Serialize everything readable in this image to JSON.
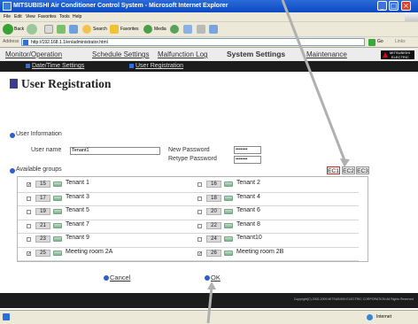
{
  "window": {
    "title": "MITSUBISHI Air Conditioner Control System - Microsoft Internet Explorer"
  },
  "menu_items": [
    "File",
    "Edit",
    "View",
    "Favorites",
    "Tools",
    "Help"
  ],
  "toolbar": {
    "back_label": "Back",
    "search_label": "Search",
    "favorites_label": "Favorites",
    "media_label": "Media"
  },
  "address_bar": {
    "label": "Address",
    "url": "http://192.168.1.1/en/administrator.html",
    "go_label": "Go",
    "links_label": "Links"
  },
  "nav": {
    "monitor": "Monitor/Operation",
    "schedule": "Schedule Settings",
    "malfunction": "Malfunction Log",
    "system": "System Settings",
    "maintenance": "Maintenance",
    "brand_line1": "MITSUBISHI",
    "brand_line2": "ELECTRIC"
  },
  "subnav": {
    "datetime": "Date/Time Settings",
    "user_reg": "User Registration"
  },
  "page": {
    "title": "User Registration"
  },
  "user_info": {
    "section_label": "User Information",
    "username_label": "User name",
    "username_value": "Tenant1",
    "new_password_label": "New Password",
    "new_password_value": "•••••••",
    "retype_password_label": "Retype Password",
    "retype_password_value": "•••••••"
  },
  "groups": {
    "section_label": "Available groups",
    "ec_buttons": [
      "EC1",
      "EC2",
      "EC3"
    ],
    "selected_ec": "EC1",
    "left_column": [
      {
        "checked": true,
        "num": "15",
        "name": "Tenant 1"
      },
      {
        "checked": false,
        "num": "17",
        "name": "Tenant 3"
      },
      {
        "checked": false,
        "num": "19",
        "name": "Tenant 5"
      },
      {
        "checked": false,
        "num": "21",
        "name": "Tenant 7"
      },
      {
        "checked": false,
        "num": "23",
        "name": "Tenant 9"
      },
      {
        "checked": true,
        "num": "25",
        "name": "Meeting room 2A"
      }
    ],
    "right_column": [
      {
        "checked": false,
        "num": "16",
        "name": "Tenant 2"
      },
      {
        "checked": false,
        "num": "18",
        "name": "Tenant 4"
      },
      {
        "checked": false,
        "num": "20",
        "name": "Tenant 6"
      },
      {
        "checked": false,
        "num": "22",
        "name": "Tenant 8"
      },
      {
        "checked": false,
        "num": "24",
        "name": "Tenant10"
      },
      {
        "checked": true,
        "num": "26",
        "name": "Meeting room 2B"
      }
    ]
  },
  "actions": {
    "cancel": "Cancel",
    "ok": "OK"
  },
  "footer": {
    "copyright": "Copyright(C) 2002-2009 MITSUBISHI ELECTRIC CORPORATION All Rights Reserved"
  },
  "status_bar": {
    "zone": "Internet"
  },
  "colors": {
    "title_bar": "#0b4ac2",
    "nav_bg": "#ececec",
    "subnav_bg": "#1c1c1c",
    "bullet_blue": "#2c5fd0",
    "ec_selected_border": "#dd2222"
  }
}
